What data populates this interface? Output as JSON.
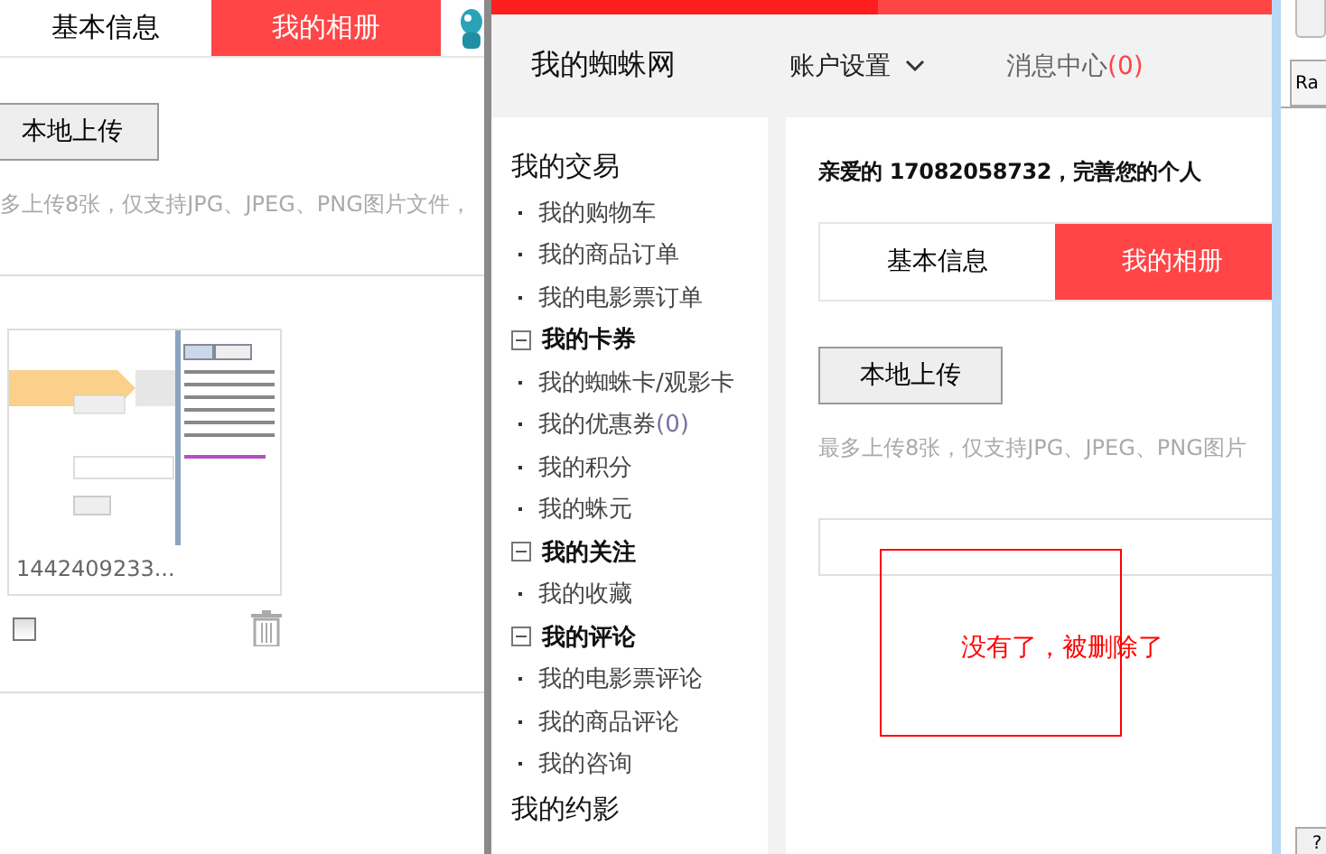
{
  "left_pane": {
    "tabs": [
      {
        "label": "基本信息",
        "selected": false
      },
      {
        "label": "我的相册",
        "selected": true
      }
    ],
    "upload_button": "本地上传",
    "hint": "多上传8张，仅支持JPG、JPEG、PNG图片文件，",
    "photos": [
      {
        "caption": "1442409233...",
        "checked": false
      }
    ]
  },
  "window": {
    "logo": "我的蜘蛛网",
    "nav": [
      {
        "label": "账户设置",
        "kind": "dropdown"
      },
      {
        "label": "消息中心",
        "count": "(0)",
        "kind": "link"
      }
    ],
    "sidebar": {
      "sections": [
        {
          "title": "我的交易",
          "kind": "heading",
          "items": [
            {
              "label": "我的购物车"
            },
            {
              "label": "我的商品订单"
            },
            {
              "label": "我的电影票订单"
            }
          ]
        },
        {
          "title": "我的卡券",
          "kind": "collapsible",
          "expanded": true,
          "items": [
            {
              "label": "我的蜘蛛卡/观影卡"
            },
            {
              "label": "我的优惠券",
              "count": "(0)"
            },
            {
              "label": "我的积分"
            },
            {
              "label": "我的蛛元"
            }
          ]
        },
        {
          "title": "我的关注",
          "kind": "collapsible",
          "expanded": true,
          "items": [
            {
              "label": "我的收藏"
            }
          ]
        },
        {
          "title": "我的评论",
          "kind": "collapsible",
          "expanded": true,
          "items": [
            {
              "label": "我的电影票评论"
            },
            {
              "label": "我的商品评论"
            },
            {
              "label": "我的咨询"
            }
          ]
        },
        {
          "title": "我的约影",
          "kind": "heading"
        }
      ]
    },
    "greeting": "亲爱的 17082058732，完善您的个人",
    "tabs": [
      {
        "label": "基本信息",
        "selected": false
      },
      {
        "label": "我的相册",
        "selected": true
      }
    ],
    "upload_button": "本地上传",
    "hint": "最多上传8张，仅支持JPG、JPEG、PNG图片",
    "annotation": "没有了，被删除了"
  },
  "right_window": {
    "tab": "Ra",
    "help_button": "?"
  }
}
